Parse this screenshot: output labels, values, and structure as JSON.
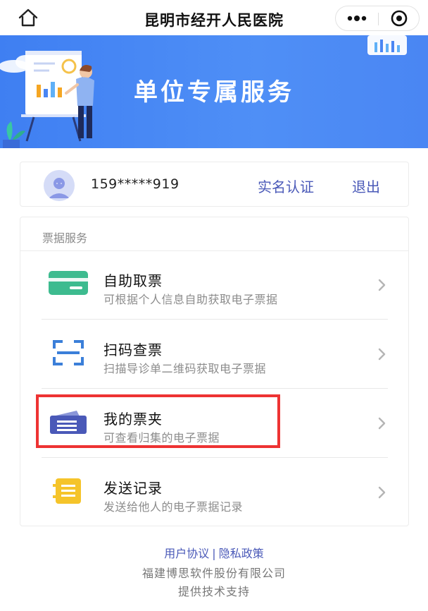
{
  "nav": {
    "title": "昆明市经开人民医院",
    "home_icon": "home-icon",
    "more_icon": "more-dots-icon",
    "close_icon": "close-circle-icon"
  },
  "banner": {
    "title": "单位专属服务"
  },
  "user": {
    "phone": "159*****919",
    "verify_label": "实名认证",
    "logout_label": "退出"
  },
  "services": {
    "section_label": "票据服务",
    "items": [
      {
        "title": "自助取票",
        "desc": "可根据个人信息自助获取电子票据",
        "icon": "ticket-card-icon",
        "icon_color": "#3dbb8f"
      },
      {
        "title": "扫码查票",
        "desc": "扫描导诊单二维码获取电子票据",
        "icon": "scan-icon",
        "icon_color": "#3b7fd9"
      },
      {
        "title": "我的票夹",
        "desc": "可查看归集的电子票据",
        "icon": "ticket-wallet-icon",
        "icon_color": "#4a59b8"
      },
      {
        "title": "发送记录",
        "desc": "发送给他人的电子票据记录",
        "icon": "record-list-icon",
        "icon_color": "#f5c42a"
      }
    ]
  },
  "footer": {
    "user_agreement": "用户协议",
    "separator": "|",
    "privacy_policy": "隐私政策",
    "company": "福建博思软件股份有限公司",
    "support": "提供技术支持"
  },
  "colors": {
    "accent": "#4a59b8",
    "banner": "#4a86f3",
    "highlight": "#ee3333"
  }
}
